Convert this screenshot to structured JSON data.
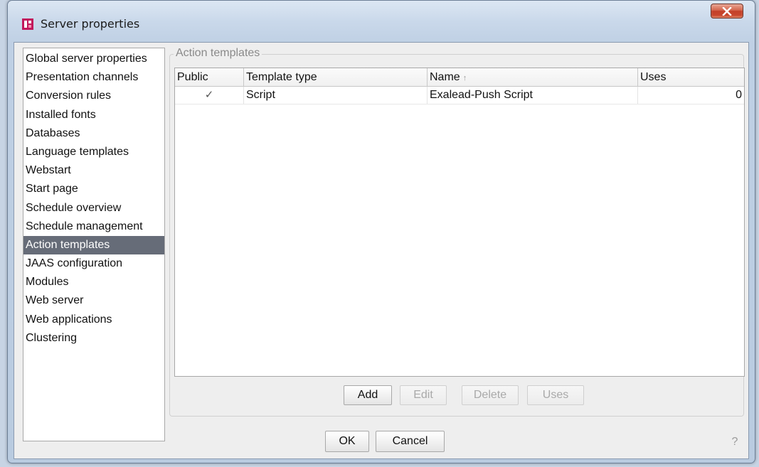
{
  "window": {
    "title": "Server properties",
    "close_label": "x"
  },
  "sidebar": {
    "items": [
      {
        "label": "Global server properties"
      },
      {
        "label": "Presentation channels"
      },
      {
        "label": "Conversion rules"
      },
      {
        "label": "Installed fonts"
      },
      {
        "label": "Databases"
      },
      {
        "label": "Language templates"
      },
      {
        "label": "Webstart"
      },
      {
        "label": "Start page"
      },
      {
        "label": "Schedule overview"
      },
      {
        "label": "Schedule management"
      },
      {
        "label": "Action templates",
        "selected": true
      },
      {
        "label": "JAAS configuration"
      },
      {
        "label": "Modules"
      },
      {
        "label": "Web server"
      },
      {
        "label": "Web applications"
      },
      {
        "label": "Clustering"
      }
    ]
  },
  "panel": {
    "group_title": "Action templates",
    "columns": {
      "public": "Public",
      "type": "Template type",
      "name": "Name",
      "uses": "Uses"
    },
    "sort_indicator": "↑",
    "rows": [
      {
        "public_checked": true,
        "check_glyph": "✓",
        "type": "Script",
        "name": "Exalead-Push Script",
        "uses": "0"
      }
    ],
    "buttons": {
      "add": "Add",
      "edit": "Edit",
      "delete": "Delete",
      "uses": "Uses"
    }
  },
  "footer": {
    "ok": "OK",
    "cancel": "Cancel",
    "help": "?"
  },
  "colors": {
    "selection": "#666c78",
    "close_button": "#c4412a"
  }
}
